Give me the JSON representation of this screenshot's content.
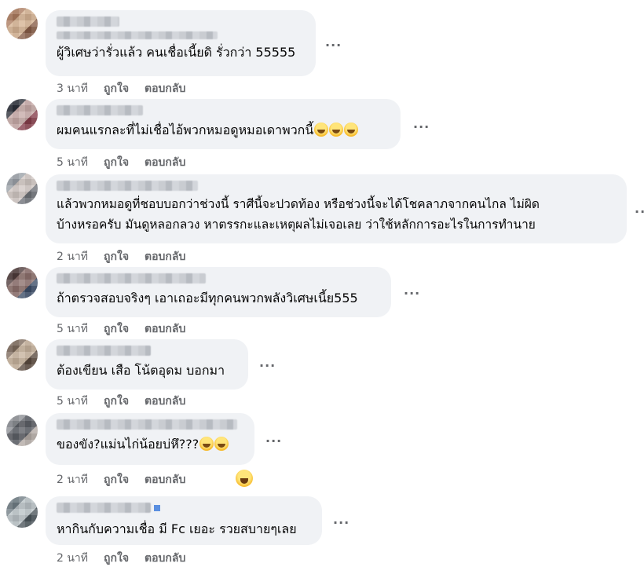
{
  "comments": [
    {
      "text": "ผู้วิเศษว่ารั่วแล้ว คนเชื่อเนี้ยดิ รั่วกว่า 55555",
      "time": "3 นาที",
      "like": "ถูกใจ",
      "reply": "ตอบกลับ",
      "more": "...",
      "avatar_colors": [
        "#b07a5a",
        "#d9b38f",
        "#8a5b43"
      ]
    },
    {
      "text": "ผมคนแรกละที่ไม่เชื่อไอ้พวกหมอดูหมอเดาพวกนี้",
      "emojis": [
        "laughing-crying-emoji",
        "laughing-crying-emoji",
        "smiling-emoji"
      ],
      "time": "5 นาที",
      "like": "ถูกใจ",
      "reply": "ตอบกลับ",
      "more": "...",
      "avatar_colors": [
        "#2b2f3a",
        "#c9a9a6",
        "#8b3b4a"
      ]
    },
    {
      "text_line1": "แล้วพวกหมอดูที่ชอบบอกว่าช่วงนี้ ราศีนี้จะปวดท้อง หรือช่วงนี้จะได้โชคลาภจากคนไกล ไม่ผิด",
      "text_line2": "บ้างหรอครับ มันดูหลอกลวง หาตรรกะและเหตุผลไม่เจอเลย ว่าใช้หลักการอะไรในการทำนาย",
      "time": "2 นาที",
      "like": "ถูกใจ",
      "reply": "ตอบกลับ",
      "more": "...",
      "avatar_colors": [
        "#9aa0a8",
        "#d2c7c2",
        "#6d7178"
      ]
    },
    {
      "text": "ถ้าตรวจสอบจริงๆ เอาเถอะมีทุกคนพวกพลังวิเศษเนี้ย555",
      "time": "5 นาที",
      "like": "ถูกใจ",
      "reply": "ตอบกลับ",
      "more": "...",
      "avatar_colors": [
        "#4f3b3a",
        "#8f6f6b",
        "#3a4c6a"
      ]
    },
    {
      "text": "ต้องเขียน เสือ โน้ตอุดม บอกมา",
      "time": "5 นาที",
      "like": "ถูกใจ",
      "reply": "ตอบกลับ",
      "more": "...",
      "avatar_colors": [
        "#7e6a5a",
        "#c8b29a",
        "#5b4a3d"
      ]
    },
    {
      "text": "ของขัง?แม่นไก่น้อยบ่หึ???",
      "emojis": [
        "laughing-crying-emoji",
        "laughing-crying-emoji"
      ],
      "time": "2 นาที",
      "like": "ถูกใจ",
      "reply": "ตอบกลับ",
      "more": "...",
      "reaction": "laughing-reaction-icon",
      "avatar_colors": [
        "#8c8f95",
        "#5d6068",
        "#b3a9a3"
      ]
    },
    {
      "text": "หากินกับความเชื่อ มี Fc เยอะ รวยสบายๆเลย",
      "time": "2 นาที",
      "like": "ถูกใจ",
      "reply": "ตอบกลับ",
      "more": "...",
      "avatar_colors": [
        "#6f7d86",
        "#b9c3c8",
        "#4a555c"
      ]
    }
  ]
}
